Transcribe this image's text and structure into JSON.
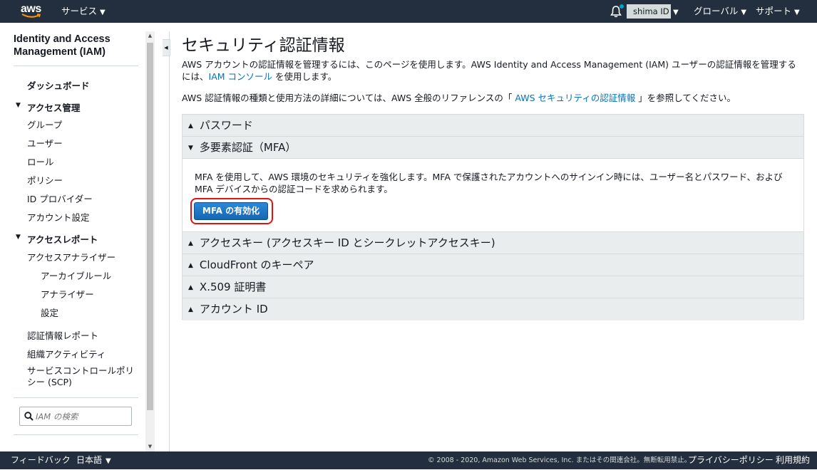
{
  "topbar": {
    "logo_text": "aws",
    "services_label": "サービス",
    "account_label": "shima ID",
    "region_label": "グローバル",
    "support_label": "サポート"
  },
  "sidebar": {
    "title": "Identity and Access Management (IAM)",
    "dashboard": "ダッシュボード",
    "access_management": "アクセス管理",
    "groups": "グループ",
    "users": "ユーザー",
    "roles": "ロール",
    "policies": "ポリシー",
    "id_providers": "ID プロバイダー",
    "account_settings": "アカウント設定",
    "access_reports": "アクセスレポート",
    "access_analyzer": "アクセスアナライザー",
    "archive_rules": "アーカイブルール",
    "analyzers": "アナライザー",
    "settings": "設定",
    "credential_report": "認証情報レポート",
    "org_activity": "組織アクティビティ",
    "scp": "サービスコントロールポリシー (SCP)",
    "search_placeholder": "IAM の検索"
  },
  "main": {
    "title": "セキュリティ認証情報",
    "intro_1_a": "AWS アカウントの認証情報を管理するには、このページを使用します。AWS Identity and Access Management (IAM) ユーザーの認証情報を管理するには、",
    "intro_1_link": "IAM コンソール",
    "intro_1_b": "を使用します。",
    "intro_2_a": "AWS 認証情報の種類と使用方法の詳細については、AWS 全般のリファレンスの「",
    "intro_2_link": "AWS セキュリティの認証情報",
    "intro_2_b": "」を参照してください。",
    "sections": [
      {
        "label": "パスワード",
        "arrow": "▲"
      },
      {
        "label": "多要素認証（MFA）",
        "arrow": "▼"
      },
      {
        "label": "アクセスキー (アクセスキー ID とシークレットアクセスキー)",
        "arrow": "▲"
      },
      {
        "label": "CloudFront のキーペア",
        "arrow": "▲"
      },
      {
        "label": "X.509 証明書",
        "arrow": "▲"
      },
      {
        "label": "アカウント ID",
        "arrow": "▲"
      }
    ],
    "mfa_text": "MFA を使用して、AWS 環境のセキュリティを強化します。MFA で保護されたアカウントへのサインイン時には、ユーザー名とパスワード、および MFA デバイスからの認証コードを求められます。",
    "mfa_button": "MFA の有効化"
  },
  "footer": {
    "feedback": "フィードバック",
    "language": "日本語",
    "copyright": "© 2008 - 2020, Amazon Web Services, Inc. またはその関連会社。無断転用禁止。",
    "privacy": "プライバシーポリシー",
    "terms": "利用規約"
  },
  "colors": {
    "topbar": "#232f3e",
    "link": "#0073bb",
    "button": "#1f77c9",
    "highlight": "#e0140f"
  }
}
